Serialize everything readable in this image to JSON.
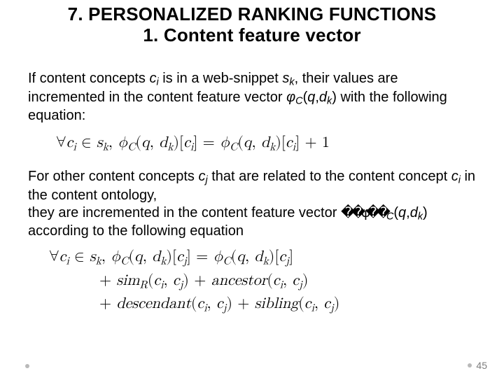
{
  "title": "7. PERSONALIZED RANKING FUNCTIONS\n1. Content feature vector",
  "para1": {
    "prefix": "If content concepts ",
    "ci": "c",
    "ci_sub": "i",
    "mid1": " is in a web-snippet ",
    "sk": "s",
    "sk_sub": "k",
    "mid2": ", their values are incremented in the content feature vector ",
    "phi": "φ",
    "phi_sub": "C",
    "args_open": "(",
    "q": "q",
    "comma": ",",
    "dk": "d",
    "dk_sub": "k",
    "args_close": ")",
    "suffix": " with the following equation:"
  },
  "eq1": "∀cᵢ ∈ sₖ, ϕ_C(q, dₖ)[cᵢ] = ϕ_C(q, dₖ)[cᵢ] + 1",
  "para2": {
    "l1a": "For other content concepts ",
    "cj": "c",
    "cj_sub": "j",
    "l1b": " that are related to the content concept ",
    "ci": "c",
    "ci_sub": "i",
    "l1c": " in the content ontology,",
    "l2a": "they are incremented in the content feature vector ",
    "glitch": "��φ��",
    "phi_sub": "C",
    "args_open": "(",
    "q": "q",
    "comma": ",",
    "dk": "d",
    "dk_sub": "k",
    "args_close": ")",
    "l2b": " according to the following equation"
  },
  "eq2": {
    "line1": "∀cᵢ ∈ sₖ, ϕ_C(q, dₖ)[cⱼ] = ϕ_C(q, dₖ)[cⱼ]",
    "line2": "+ sim_R(cᵢ, cⱼ) + ancestor(cᵢ, cⱼ)",
    "line3": "+ descendant(cᵢ, cⱼ) + sibling(cᵢ, cⱼ)"
  },
  "pagenum": "45"
}
